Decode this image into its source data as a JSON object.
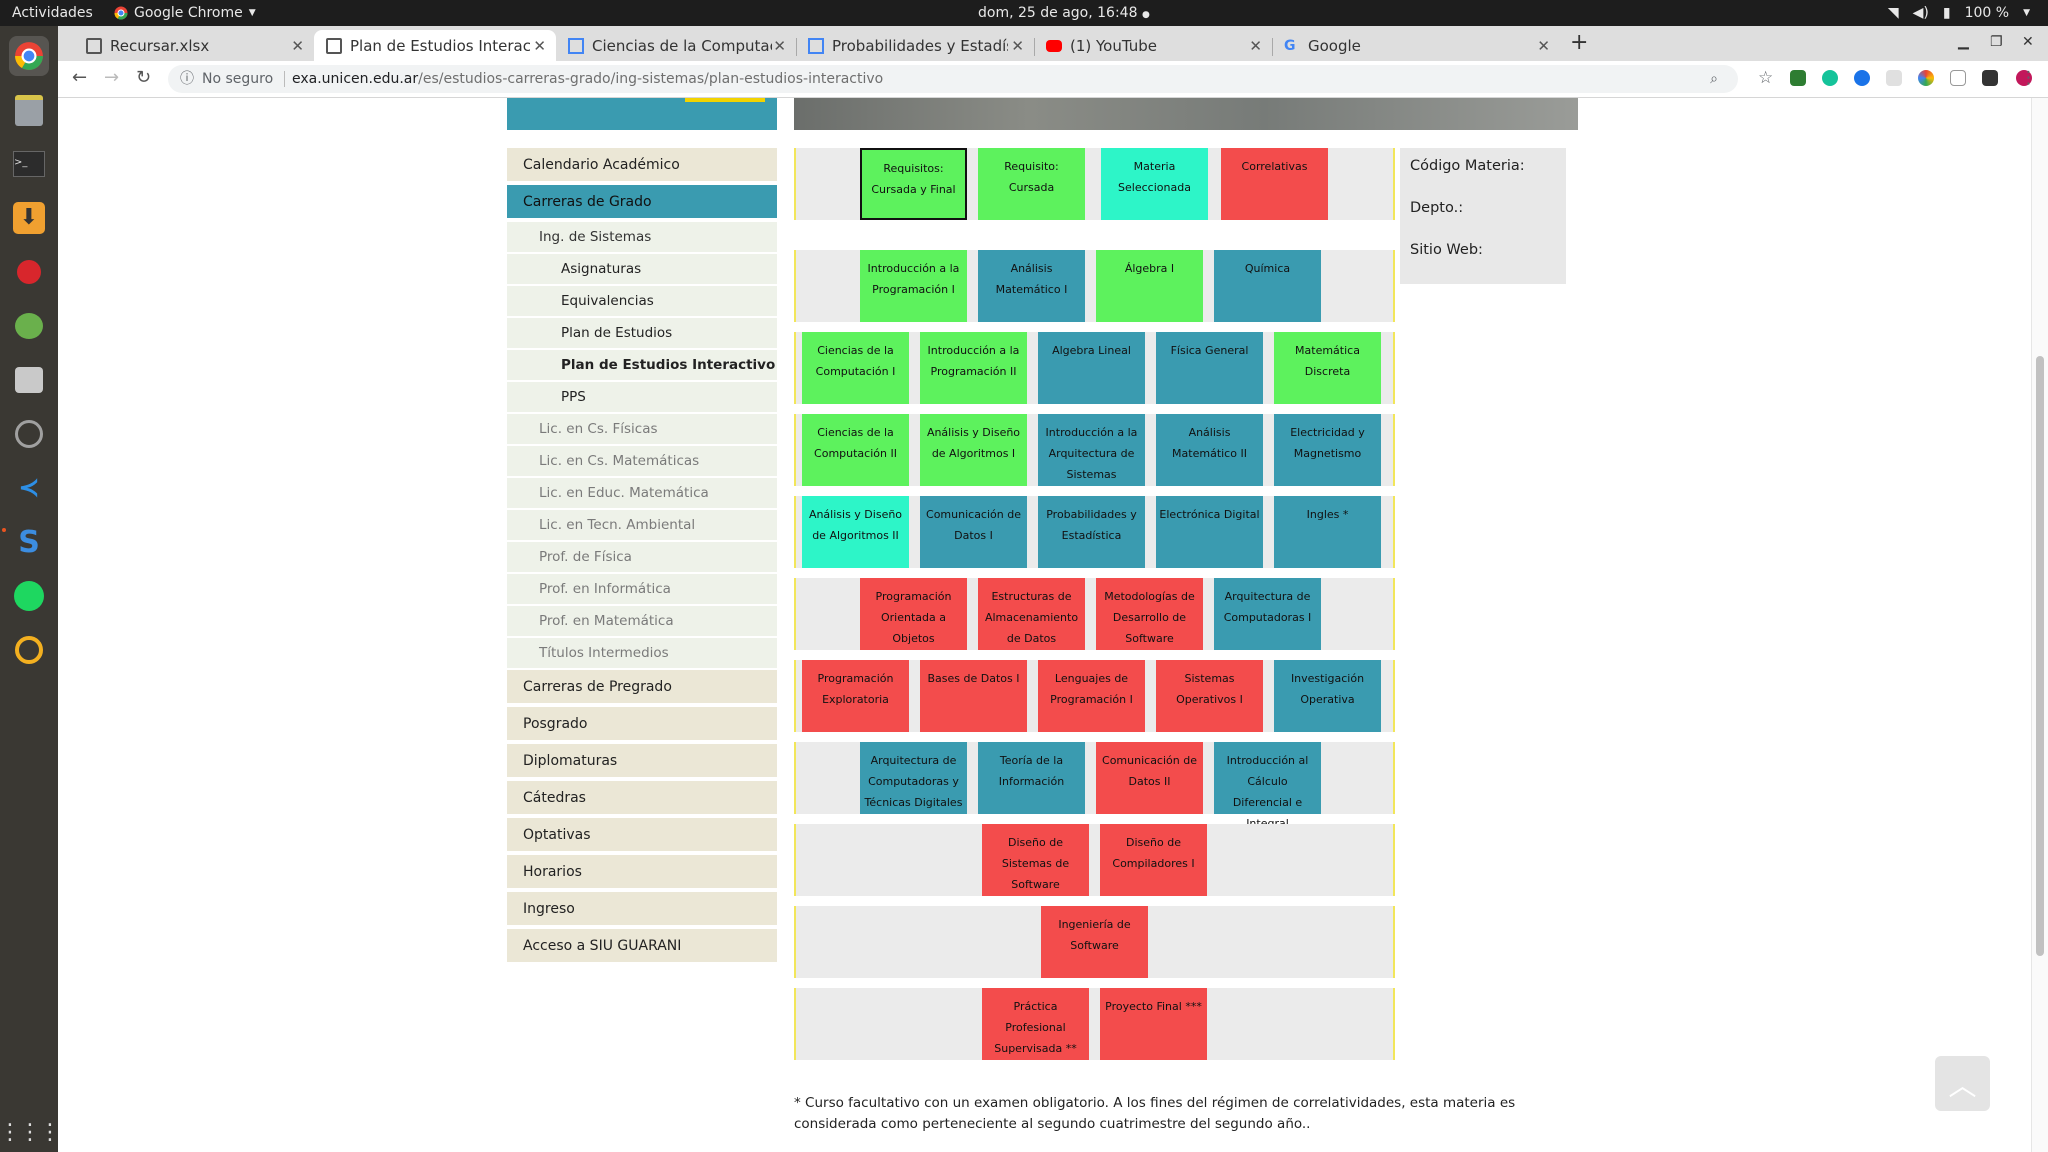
{
  "topbar": {
    "activities": "Actividades",
    "app_name": "Google Chrome",
    "clock": "dom, 25 de ago, 16:48",
    "battery": "100 %"
  },
  "tabs": [
    {
      "label": "Recursar.xlsx",
      "icon": "sheet-icon"
    },
    {
      "label": "Plan de Estudios Interactivo",
      "icon": "page-icon"
    },
    {
      "label": "Ciencias de la Computación",
      "icon": "doc-icon"
    },
    {
      "label": "Probabilidades y Estadística",
      "icon": "doc-icon"
    },
    {
      "label": "(1) YouTube",
      "icon": "youtube-icon"
    },
    {
      "label": "Google",
      "icon": "google-icon"
    }
  ],
  "address": {
    "security": "No seguro",
    "domain": "exa.unicen.edu.ar",
    "path": "/es/estudios-carreras-grado/ing-sistemas/plan-estudios-interactivo"
  },
  "menu": {
    "calendario": "Calendario Académico",
    "carreras_grado": "Carreras de Grado",
    "ing_sistemas": "Ing. de Sistemas",
    "asignaturas": "Asignaturas",
    "equivalencias": "Equivalencias",
    "plan": "Plan de Estudios",
    "plan_interactivo": "Plan de Estudios Interactivo",
    "pps": "PPS",
    "subs": [
      "Lic. en Cs. Físicas",
      "Lic. en Cs. Matemáticas",
      "Lic. en Educ. Matemática",
      "Lic. en Tecn. Ambiental",
      "Prof. de Física",
      "Prof. en Informática",
      "Prof. en Matemática",
      "Títulos Intermedios"
    ],
    "tops": [
      "Carreras de Pregrado",
      "Posgrado",
      "Diplomaturas",
      "Cátedras",
      "Optativas",
      "Horarios",
      "Ingreso",
      "Acceso a SIU GUARANI"
    ]
  },
  "legend": {
    "req_final": "Requisitos: Cursada y Final",
    "req_cursada": "Requisito: Cursada",
    "selected": "Materia Seleccionada",
    "correlativas": "Correlativas"
  },
  "info": {
    "codigo": "Código Materia:",
    "depto": "Depto.:",
    "sitio": "Sitio Web:"
  },
  "rows": [
    [
      {
        "t": "Introducción a la Programación I",
        "c": "g"
      },
      {
        "t": "Análisis Matemático I",
        "c": "b"
      },
      {
        "t": "Álgebra I",
        "c": "g"
      },
      {
        "t": "Química",
        "c": "b"
      }
    ],
    [
      {
        "t": "Ciencias de la Computación I",
        "c": "g"
      },
      {
        "t": "Introducción a la Programación II",
        "c": "g"
      },
      {
        "t": "Algebra Lineal",
        "c": "b"
      },
      {
        "t": "Física General",
        "c": "b"
      },
      {
        "t": "Matemática Discreta",
        "c": "g"
      }
    ],
    [
      {
        "t": "Ciencias de la Computación II",
        "c": "g"
      },
      {
        "t": "Análisis y Diseño de Algoritmos I",
        "c": "g"
      },
      {
        "t": "Introducción a la Arquitectura de Sistemas",
        "c": "b"
      },
      {
        "t": "Análisis Matemático II",
        "c": "b"
      },
      {
        "t": "Electricidad y Magnetismo",
        "c": "b"
      }
    ],
    [
      {
        "t": "Análisis y Diseño de Algoritmos II",
        "c": "t"
      },
      {
        "t": "Comunicación de Datos I",
        "c": "b"
      },
      {
        "t": "Probabilidades y Estadística",
        "c": "b"
      },
      {
        "t": "Electrónica Digital",
        "c": "b"
      },
      {
        "t": "Ingles *",
        "c": "b"
      }
    ],
    [
      {
        "t": "Programación Orientada a Objetos",
        "c": "r"
      },
      {
        "t": "Estructuras de Almacenamiento de Datos",
        "c": "r"
      },
      {
        "t": "Metodologías de Desarrollo de Software",
        "c": "r"
      },
      {
        "t": "Arquitectura de Computadoras I",
        "c": "b"
      }
    ],
    [
      {
        "t": "Programación Exploratoria",
        "c": "r"
      },
      {
        "t": "Bases de Datos I",
        "c": "r"
      },
      {
        "t": "Lenguajes de Programación I",
        "c": "r"
      },
      {
        "t": "Sistemas Operativos I",
        "c": "r"
      },
      {
        "t": "Investigación Operativa",
        "c": "b"
      }
    ],
    [
      {
        "t": "Arquitectura de Computadoras y Técnicas Digitales",
        "c": "b"
      },
      {
        "t": "Teoría de la Información",
        "c": "b"
      },
      {
        "t": "Comunicación de Datos II",
        "c": "r"
      },
      {
        "t": "Introducción al Cálculo Diferencial e Integral",
        "c": "b"
      }
    ],
    [
      {
        "t": "Diseño de Sistemas de Software",
        "c": "r"
      },
      {
        "t": "Diseño de Compiladores I",
        "c": "r"
      }
    ],
    [
      {
        "t": "Ingeniería de Software",
        "c": "r"
      }
    ],
    [
      {
        "t": "Práctica Profesional Supervisada **",
        "c": "r"
      },
      {
        "t": "Proyecto Final ***",
        "c": "r"
      }
    ]
  ],
  "footnote": "* Curso facultativo con un examen obligatorio. A los fines del régimen de correlatividades, esta materia es considerada como perteneciente al segundo cuatrimestre del segundo año.."
}
